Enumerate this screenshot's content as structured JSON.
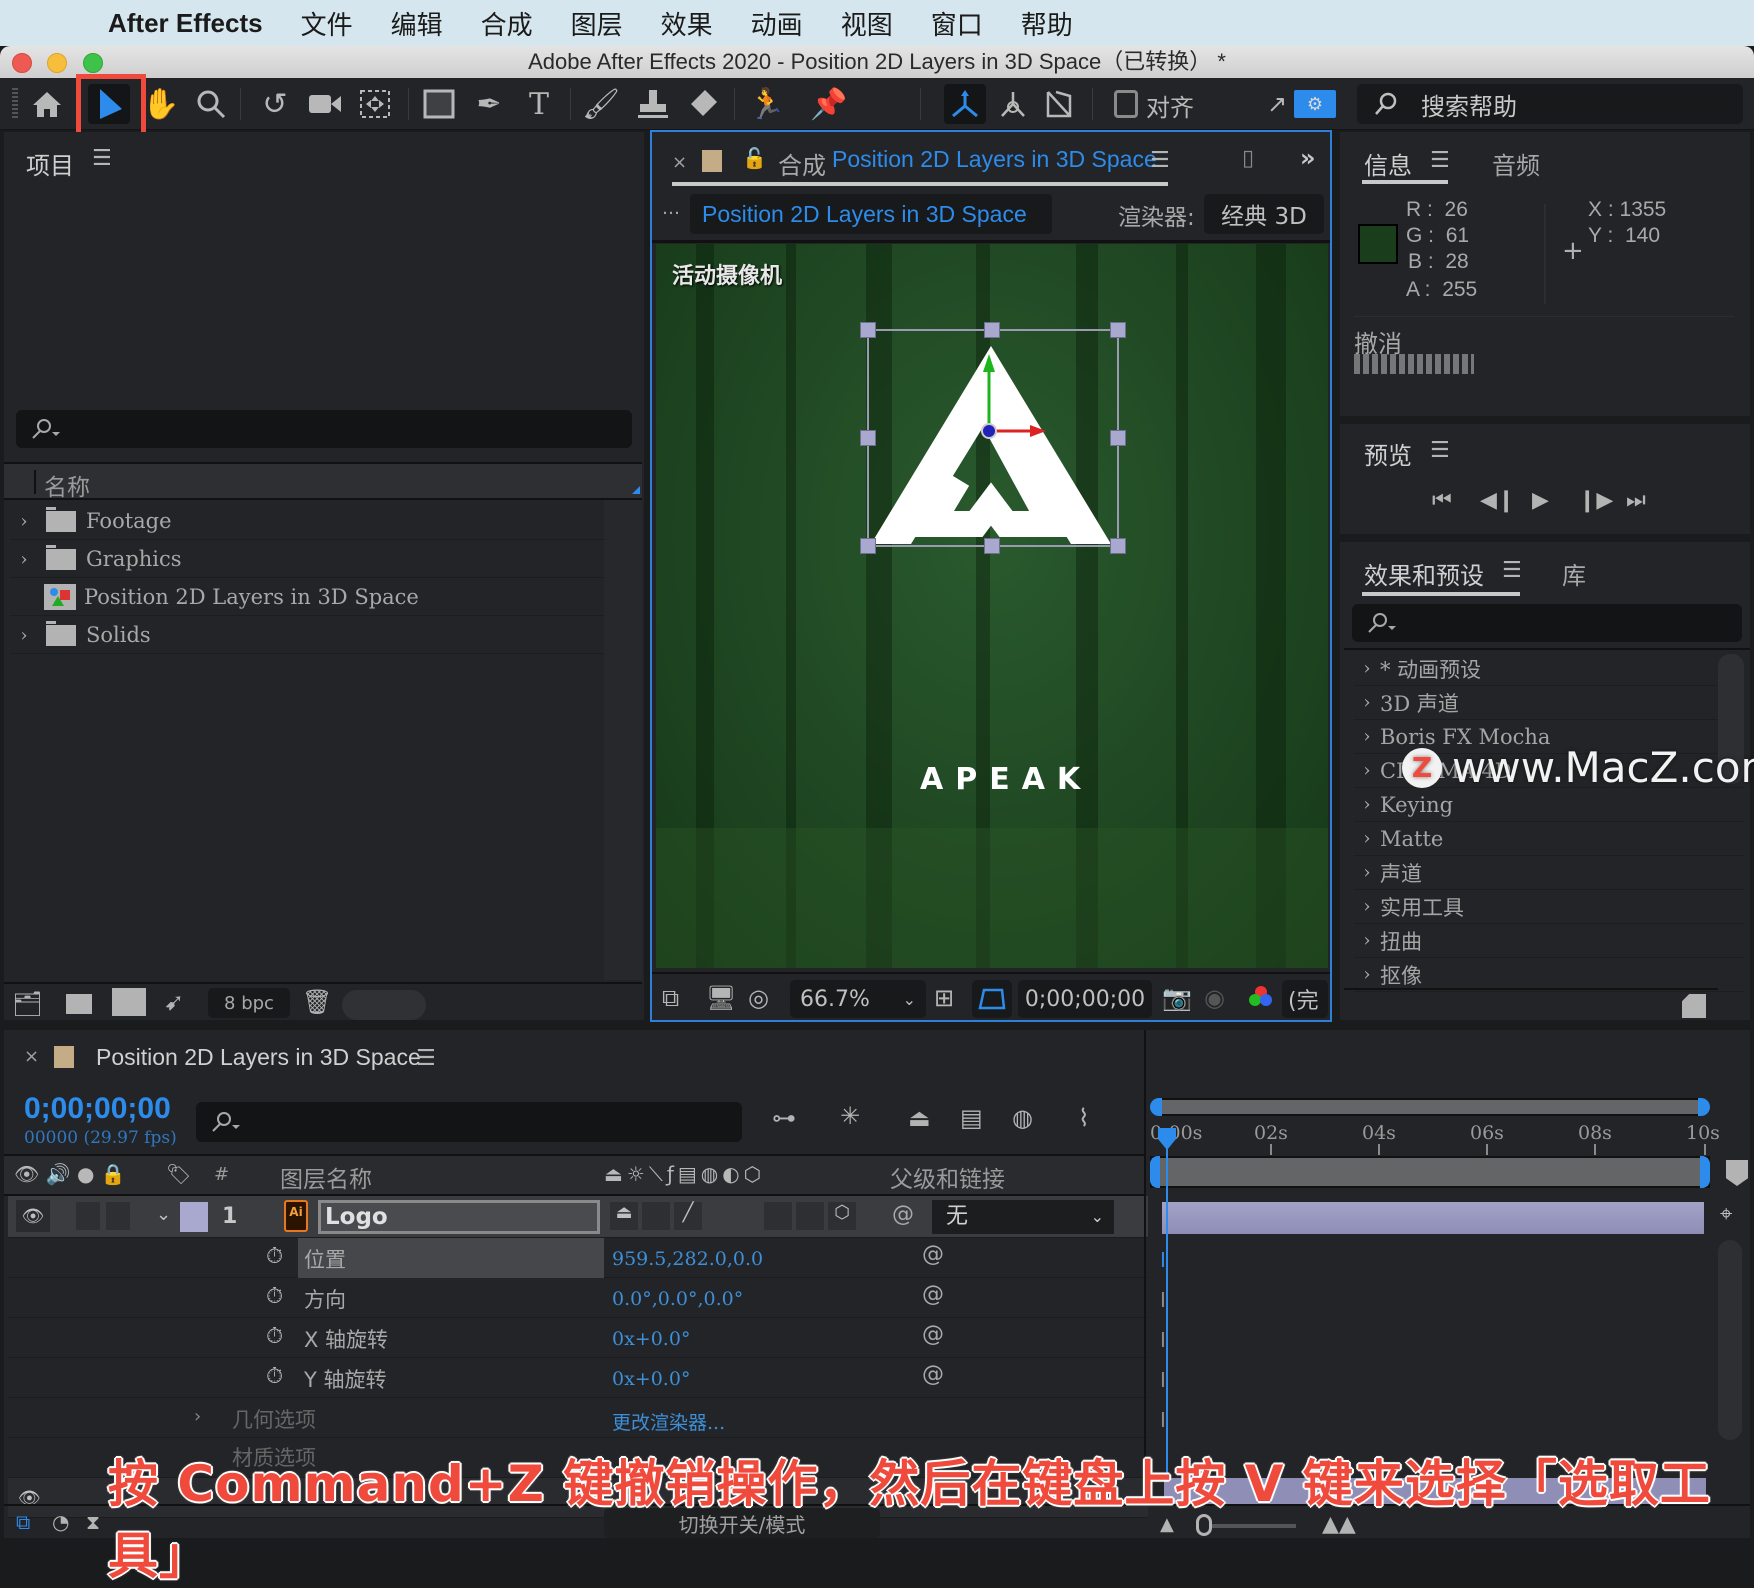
{
  "menubar": {
    "app_name": "After Effects",
    "items": [
      "文件",
      "编辑",
      "合成",
      "图层",
      "效果",
      "动画",
      "视图",
      "窗口",
      "帮助"
    ]
  },
  "window": {
    "title": "Adobe After Effects 2020 - Position 2D Layers in 3D Space（已转换） *"
  },
  "toolbar": {
    "tools": [
      "home",
      "selection",
      "hand",
      "zoom",
      "rotation",
      "camera",
      "pan-behind",
      "rectangle",
      "pen",
      "type",
      "brush",
      "clone-stamp",
      "eraser",
      "roto-brush",
      "puppet-pin"
    ],
    "selected_tool": "selection",
    "axis_modes": [
      "local-axis",
      "world-axis",
      "view-axis"
    ],
    "align_label": "对齐",
    "search_help_placeholder": "搜索帮助"
  },
  "project_panel": {
    "title": "项目",
    "column_name": "名称",
    "items": [
      {
        "name": "Footage",
        "type": "folder",
        "expandable": true
      },
      {
        "name": "Graphics",
        "type": "folder",
        "expandable": true
      },
      {
        "name": "Position 2D Layers in 3D Space",
        "type": "composition",
        "expandable": false
      },
      {
        "name": "Solids",
        "type": "folder",
        "expandable": true
      }
    ],
    "bit_depth": "8 bpc"
  },
  "composition_panel": {
    "tab_prefix": "合成",
    "tab_name": "Position 2D Layers in 3D Space",
    "breadcrumb": "Position 2D Layers in 3D Space",
    "renderer_label": "渲染器:",
    "renderer_value": "经典 3D",
    "camera_label": "活动摄像机",
    "logo_text": "APEAK",
    "zoom_value": "66.7%",
    "timecode": "0;00;00;00",
    "resolution_partial": "(完"
  },
  "info_panel": {
    "tab_info": "信息",
    "tab_audio": "音频",
    "swatch_color": "#1a3d1c",
    "r": "26",
    "g": "61",
    "b": "28",
    "a": "255",
    "x": "1355",
    "y": "140",
    "undo_label": "撤消"
  },
  "preview_panel": {
    "title": "预览"
  },
  "effects_panel": {
    "tab_effects": "效果和预设",
    "tab_library": "库",
    "items": [
      "* 动画预设",
      "3D 声道",
      "Boris FX Mocha",
      "CINEMA 4D",
      "Keying",
      "Matte",
      "声道",
      "实用工具",
      "扭曲",
      "抠像"
    ]
  },
  "timeline": {
    "tab_name": "Position 2D Layers in 3D Space",
    "timecode": "0;00;00;00",
    "frame_fps": "00000 (29.97 fps)",
    "col_hash": "#",
    "col_layer_name": "图层名称",
    "col_parent": "父级和链接",
    "ruler_ticks": [
      "0:00s",
      "02s",
      "04s",
      "06s",
      "08s",
      "10s"
    ],
    "layer": {
      "index": "1",
      "name": "Logo",
      "label_color": "#a9a9cf",
      "parent": "无"
    },
    "properties": [
      {
        "name": "位置",
        "value": "959.5,282.0,0.0"
      },
      {
        "name": "方向",
        "value": "0.0°,0.0°,0.0°"
      },
      {
        "name": "X 轴旋转",
        "value": "0x+0.0°"
      },
      {
        "name": "Y 轴旋转",
        "value": "0x+0.0°"
      }
    ],
    "geometry_options": "几何选项",
    "change_renderer": "更改渲染器...",
    "material_options": "材质选项",
    "toggle_modes": "切换开关/模式"
  },
  "overlay": {
    "watermark": "www.MacZ.com",
    "caption": "按 Command+Z 键撤销操作，然后在键盘上按 V 键来选择「选取工具」"
  },
  "colors": {
    "accent_blue": "#2d8ceb",
    "highlight_red": "#f04a3d"
  }
}
